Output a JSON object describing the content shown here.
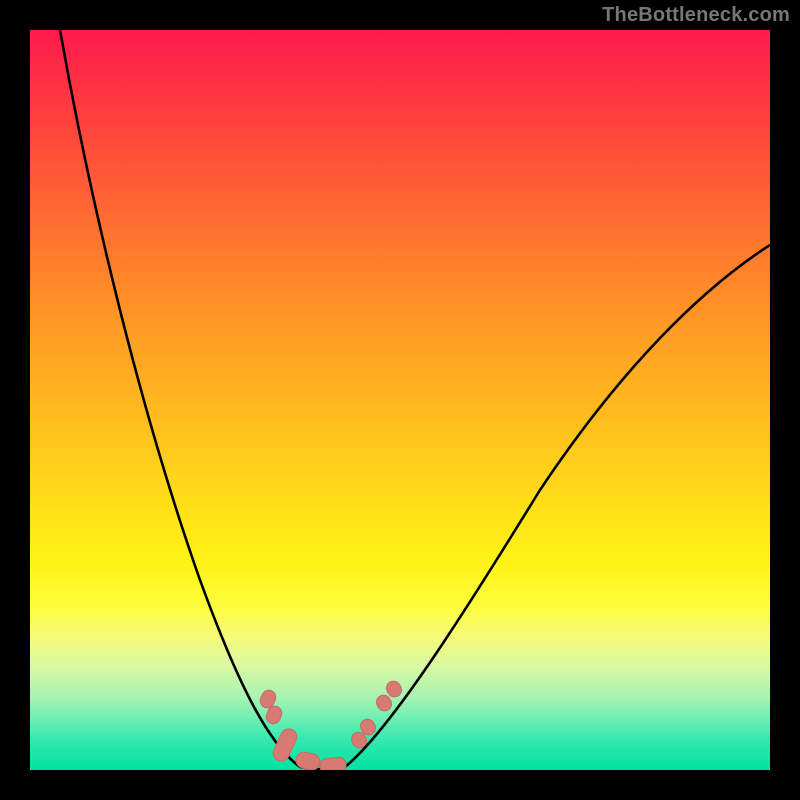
{
  "watermark": "TheBottleneck.com",
  "colors": {
    "frame": "#000000",
    "curve_stroke": "#000000",
    "marker_fill": "#d77a72",
    "marker_stroke": "#c86a64",
    "gradient_top": "#ff1a4d",
    "gradient_bottom": "#00e3a0"
  },
  "chart_data": {
    "type": "line",
    "title": "",
    "xlabel": "",
    "ylabel": "",
    "xlim": [
      0,
      100
    ],
    "ylim": [
      0,
      100
    ],
    "grid": false,
    "legend": false,
    "description": "Bottleneck V-curve on a vertical color gradient. Y-axis encodes bottleneck severity (top = 100% red, bottom = 0% green). X-axis is the balance variable. The curve dips to ~0% near x≈37–42, with salmon-colored markers clustered at the valley.",
    "series": [
      {
        "name": "left_branch",
        "x": [
          4,
          6,
          8,
          10,
          12,
          14,
          16,
          18,
          20,
          22,
          24,
          26,
          28,
          30,
          32,
          34,
          35,
          36,
          37
        ],
        "values": [
          100,
          91,
          82,
          74,
          66,
          58,
          51,
          45,
          39,
          33,
          28,
          23,
          18,
          14,
          10,
          6,
          4,
          2,
          0
        ]
      },
      {
        "name": "right_branch",
        "x": [
          42,
          44,
          46,
          48,
          50,
          54,
          58,
          62,
          66,
          70,
          75,
          80,
          85,
          90,
          95,
          100
        ],
        "values": [
          0,
          3,
          6,
          9,
          12,
          18,
          24,
          30,
          36,
          42,
          49,
          55,
          60,
          64,
          67,
          70
        ]
      }
    ],
    "markers": {
      "name": "valley_markers",
      "style": "rounded-rect",
      "x": [
        32.0,
        32.5,
        34,
        36,
        38,
        40,
        41,
        43.5,
        44.5,
        46.5,
        47.5
      ],
      "values": [
        10.0,
        8.0,
        3,
        1,
        0.5,
        0.5,
        1,
        4.0,
        6.0,
        9.0,
        11.0
      ]
    }
  }
}
